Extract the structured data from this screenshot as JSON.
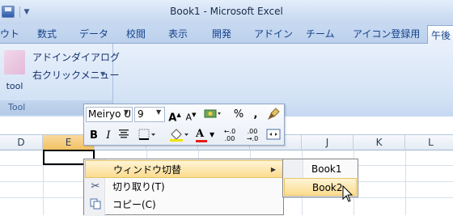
{
  "window": {
    "title": "Book1 - Microsoft Excel"
  },
  "quick_access": {
    "save_icon": "save-icon",
    "dropdown_icon": "chevron-down-icon"
  },
  "tabs": [
    {
      "label": "ウト"
    },
    {
      "label": "数式"
    },
    {
      "label": "データ"
    },
    {
      "label": "校閲"
    },
    {
      "label": "表示"
    },
    {
      "label": "開発"
    },
    {
      "label": "アドイン"
    },
    {
      "label": "チーム"
    },
    {
      "label": "アイコン登録用"
    },
    {
      "label": "午後",
      "active": true
    }
  ],
  "ribbon": {
    "tool_button_label": "tool",
    "dialog_button_label": "アドインダイアログ",
    "right_click_button_label": "右クリックメニュー",
    "group_label": "Tool"
  },
  "columns": [
    "D",
    "E",
    "F",
    "G",
    "H",
    "I",
    "J",
    "K",
    "L"
  ],
  "selected_column": "E",
  "mini_toolbar": {
    "font_name": "Meiryo U",
    "font_size": "9",
    "grow_font": "A",
    "shrink_font": "A",
    "percent": "%",
    "comma": ",",
    "bold": "B",
    "italic": "I",
    "font_color_letter": "A",
    "increase_decimal": "←.0 .00",
    "decrease_decimal": ".00 →.0",
    "highlight_color": "#f2e400",
    "font_color": "#e81c1c"
  },
  "context_menu": {
    "items": [
      {
        "label": "ウィンドウ切替",
        "highlighted": true,
        "has_submenu": true
      },
      {
        "label": "切り取り(T)",
        "icon": "scissors-icon"
      },
      {
        "label": "コピー(C)",
        "icon": "copy-icon"
      }
    ]
  },
  "submenu": {
    "items": [
      {
        "label": "Book1"
      },
      {
        "label": "Book2",
        "highlighted": true
      }
    ]
  }
}
